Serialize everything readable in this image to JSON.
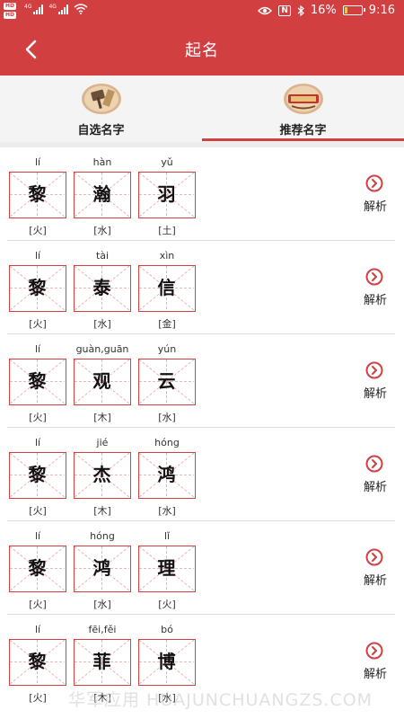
{
  "status_bar": {
    "hd1": "HD",
    "hd2": "HD",
    "net1": "4G",
    "net2": "4G",
    "battery_text": "16%",
    "battery_level": 0.16,
    "time": "9:16",
    "nfc": "N",
    "icons": [
      "eye-icon",
      "nfc-icon",
      "bluetooth-icon",
      "battery-icon",
      "wifi-icon",
      "signal-icon"
    ]
  },
  "header": {
    "title": "起名",
    "back_icon": "chevron-left-icon"
  },
  "tabs": [
    {
      "label": "自选名字",
      "icon": "gavel-icon",
      "active": false
    },
    {
      "label": "推荐名字",
      "icon": "scroll-icon",
      "active": true
    }
  ],
  "analyze_label": "解析",
  "names": [
    {
      "chars": [
        {
          "c": "黎",
          "py": "lí",
          "el": "[火]"
        },
        {
          "c": "瀚",
          "py": "hàn",
          "el": "[水]"
        },
        {
          "c": "羽",
          "py": "yǔ",
          "el": "[土]"
        }
      ]
    },
    {
      "chars": [
        {
          "c": "黎",
          "py": "lí",
          "el": "[火]"
        },
        {
          "c": "泰",
          "py": "tài",
          "el": "[水]"
        },
        {
          "c": "信",
          "py": "xìn",
          "el": "[金]"
        }
      ]
    },
    {
      "chars": [
        {
          "c": "黎",
          "py": "lí",
          "el": "[火]"
        },
        {
          "c": "观",
          "py": "guàn,guān",
          "el": "[木]"
        },
        {
          "c": "云",
          "py": "yún",
          "el": "[水]"
        }
      ]
    },
    {
      "chars": [
        {
          "c": "黎",
          "py": "lí",
          "el": "[火]"
        },
        {
          "c": "杰",
          "py": "jié",
          "el": "[木]"
        },
        {
          "c": "鸿",
          "py": "hóng",
          "el": "[水]"
        }
      ]
    },
    {
      "chars": [
        {
          "c": "黎",
          "py": "lí",
          "el": "[火]"
        },
        {
          "c": "鸿",
          "py": "hóng",
          "el": "[水]"
        },
        {
          "c": "理",
          "py": "lǐ",
          "el": "[火]"
        }
      ]
    },
    {
      "chars": [
        {
          "c": "黎",
          "py": "lí",
          "el": "[火]"
        },
        {
          "c": "菲",
          "py": "fēi,fěi",
          "el": "[木]"
        },
        {
          "c": "博",
          "py": "bó",
          "el": "[水]"
        }
      ]
    }
  ],
  "watermark": "华军应用 HUAJUNCHUANGZS.COM",
  "colors": {
    "primary": "#d23f41",
    "tab_bg": "#f4f4f4"
  }
}
